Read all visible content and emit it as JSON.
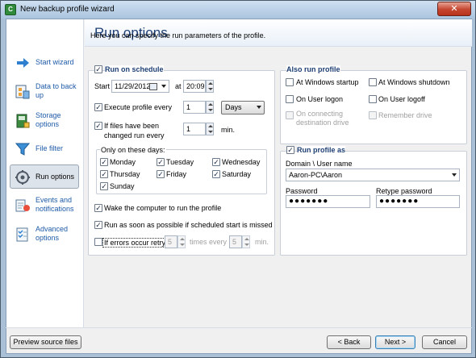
{
  "window": {
    "title": "New backup profile wizard",
    "close_glyph": "✕"
  },
  "sidebar": {
    "items": [
      {
        "label": "Start wizard",
        "icon": "arrow-right-icon"
      },
      {
        "label": "Data to back up",
        "icon": "data-icon"
      },
      {
        "label": "Storage options",
        "icon": "storage-icon"
      },
      {
        "label": "File filter",
        "icon": "filter-icon"
      },
      {
        "label": "Run options",
        "icon": "run-options-icon"
      },
      {
        "label": "Events and notifications",
        "icon": "events-icon"
      },
      {
        "label": "Advanced options",
        "icon": "advanced-icon"
      }
    ]
  },
  "header": {
    "title": "Run options",
    "subtitle": "Here you can specify the run parameters of the profile."
  },
  "schedule": {
    "title": "Run on schedule",
    "checked": true,
    "start_label": "Start",
    "start_date": "11/29/2012",
    "at_label": "at",
    "start_time": "20:09",
    "execute_label": "Execute profile every",
    "execute_checked": true,
    "execute_value": "1",
    "execute_unit": "Days",
    "changed_label_line1": "If files have been",
    "changed_label_line2": "changed run every",
    "changed_checked": true,
    "changed_value": "1",
    "changed_unit": "min.",
    "days_title": "Only on these days:",
    "days": [
      {
        "label": "Monday",
        "checked": true
      },
      {
        "label": "Tuesday",
        "checked": true
      },
      {
        "label": "Wednesday",
        "checked": true
      },
      {
        "label": "Thursday",
        "checked": true
      },
      {
        "label": "Friday",
        "checked": true
      },
      {
        "label": "Saturday",
        "checked": true
      },
      {
        "label": "Sunday",
        "checked": true
      }
    ],
    "wake_label": "Wake the computer to run the profile",
    "wake_checked": true,
    "asap_label": "Run as soon as possible if scheduled start is missed",
    "asap_checked": true,
    "retry_label": "If errors occur retry",
    "retry_checked": false,
    "retry_value": "5",
    "times_every_label": "times every",
    "retry_interval": "5",
    "retry_unit": "min."
  },
  "also_run": {
    "title": "Also run profile",
    "options": [
      {
        "label": "At Windows startup",
        "checked": false,
        "disabled": false
      },
      {
        "label": "At Windows shutdown",
        "checked": false,
        "disabled": false
      },
      {
        "label": "On User logon",
        "checked": false,
        "disabled": false
      },
      {
        "label": "On User logoff",
        "checked": false,
        "disabled": false
      },
      {
        "label_line1": "On connecting",
        "label_line2": "destination drive",
        "checked": false,
        "disabled": true
      },
      {
        "label": "Remember drive",
        "checked": false,
        "disabled": true
      }
    ]
  },
  "run_as": {
    "title": "Run profile as",
    "checked": true,
    "user_label": "Domain \\ User name",
    "user_value": "Aaron-PC\\Aaron",
    "password_label": "Password",
    "password_value": "●●●●●●●",
    "retype_label": "Retype password",
    "retype_value": "●●●●●●●"
  },
  "footer": {
    "preview_label": "Preview source files",
    "back_label": "< Back",
    "next_label": "Next >",
    "cancel_label": "Cancel"
  }
}
